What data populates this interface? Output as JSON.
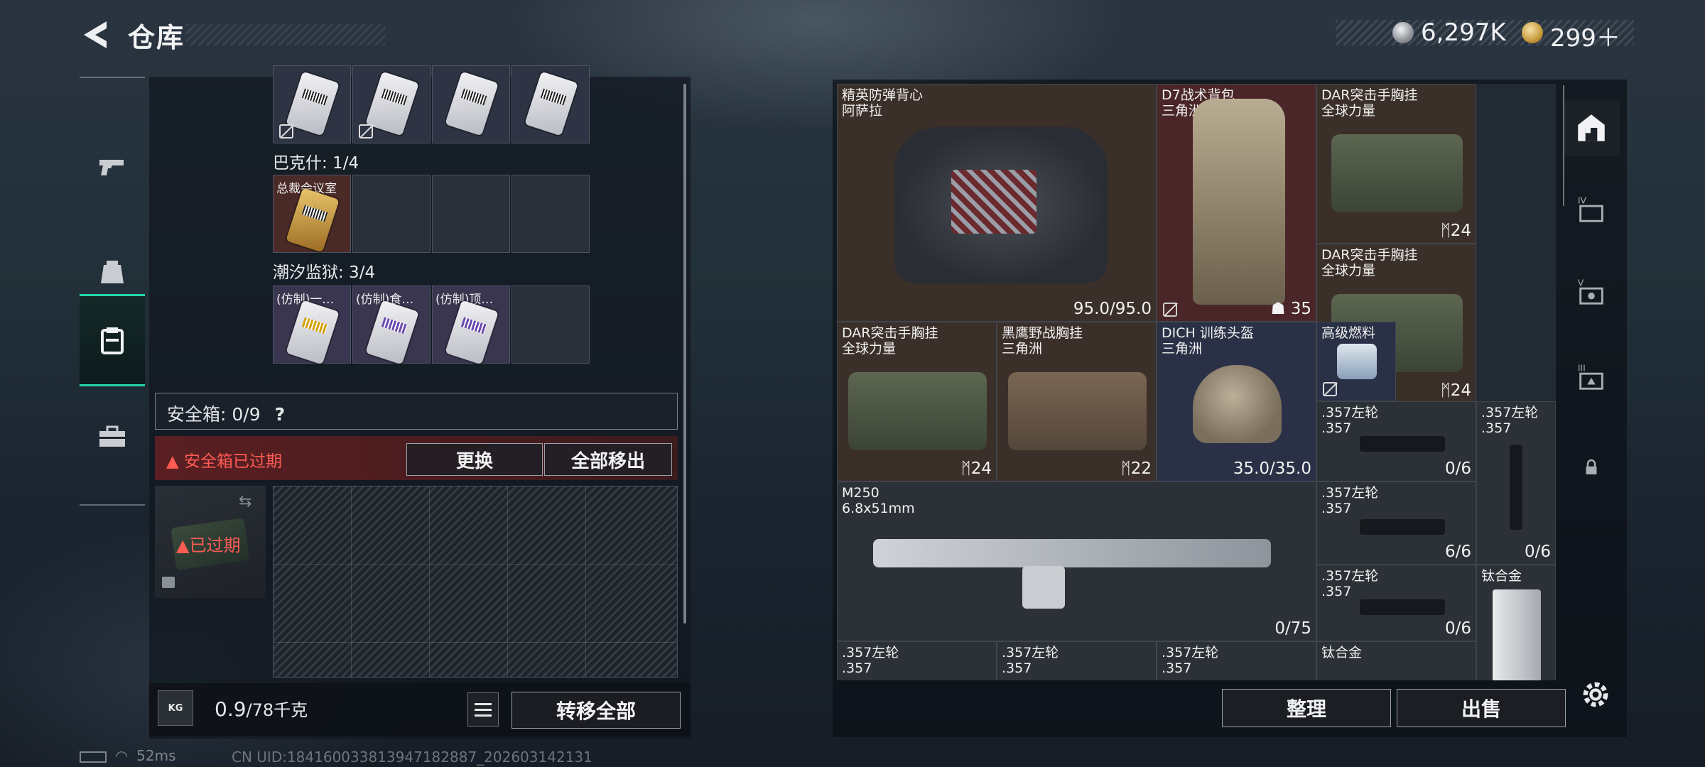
{
  "header": {
    "title": "仓库",
    "currency1": "6,297K",
    "currency2": "299＋"
  },
  "left_sidebar": {
    "tabs": [
      "weapons",
      "equipment",
      "containers",
      "toolbox"
    ]
  },
  "key_rows": [
    {
      "title": "",
      "slots": [
        "",
        "",
        "",
        ""
      ]
    },
    {
      "title": "巴克什: 1/4",
      "slots": [
        "总裁会议室",
        "",
        "",
        ""
      ]
    },
    {
      "title": "潮汐监狱: 3/4",
      "slots": [
        "(仿制)一…",
        "(仿制)食…",
        "(仿制)顶…",
        ""
      ]
    }
  ],
  "safebox": {
    "label": "安全箱: 0/9",
    "help": "?",
    "expired_warning": "安全箱已过期",
    "replace_button": "更换",
    "remove_all_button": "全部移出",
    "case_status": "已过期"
  },
  "footer_left": {
    "weight_icon": "KG",
    "weight_value": "0.9",
    "weight_max": "/78千克",
    "transfer_all_button": "转移全部"
  },
  "inventory": [
    {
      "name": "精英防弹背心\n阿萨拉",
      "value": "95.0/95.0"
    },
    {
      "name": "D7战术背包\n三角洲",
      "value": "35"
    },
    {
      "name": "DAR突击手胸挂\n全球力量",
      "value": "24"
    },
    {
      "name": "DAR突击手胸挂\n全球力量",
      "value": "24"
    },
    {
      "name": "DAR突击手胸挂\n全球力量",
      "value": "24"
    },
    {
      "name": "黑鹰野战胸挂\n三角洲",
      "value": "22"
    },
    {
      "name": "DICH 训练头盔\n三角洲",
      "value": "35.0/35.0"
    },
    {
      "name": "高级燃料",
      "value": ""
    },
    {
      "name": ".357左轮\n.357",
      "value": "0/6"
    },
    {
      "name": ".357左轮\n.357",
      "value": "0/6"
    },
    {
      "name": "M250\n6.8x51mm",
      "value": "0/75"
    },
    {
      "name": ".357左轮\n.357",
      "value": "6/6"
    },
    {
      "name": ".357左轮\n.357",
      "value": "0/6"
    },
    {
      "name": "钛合金",
      "value": ""
    },
    {
      "name": ".357左轮\n.357",
      "value": ""
    },
    {
      "name": ".357左轮\n.357",
      "value": ""
    },
    {
      "name": ".357左轮\n.357",
      "value": ""
    },
    {
      "name": "钛合金",
      "value": ""
    }
  ],
  "right_sidebar": {
    "tabs": [
      "storage",
      "IV",
      "V",
      "III",
      "lock"
    ]
  },
  "footer_right": {
    "sort_button": "整理",
    "sell_button": "出售"
  },
  "status_bar": {
    "ping": "52ms",
    "uid": "CN UID:18416003381394718​2887_202603142131"
  },
  "colors": {
    "accent": "#27d6a8",
    "warning": "#ff5b54",
    "expired_bg": "#5a1f22"
  }
}
